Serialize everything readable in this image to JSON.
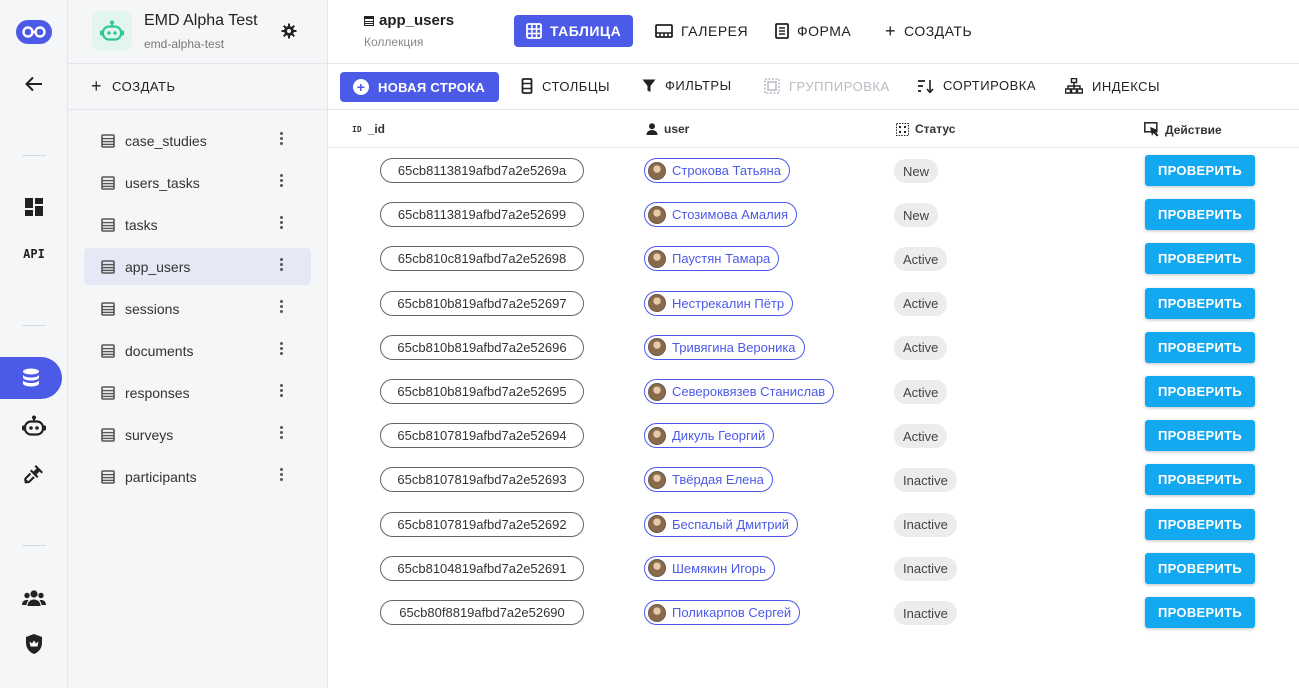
{
  "rail": {
    "api_label": "API",
    "items": [
      "logo-icon",
      "back-arrow-icon",
      "dashboard-icon",
      "api-icon",
      "database-icon",
      "bot-icon",
      "plug-icon",
      "users-icon",
      "shield-icon"
    ]
  },
  "project": {
    "name": "EMD Alpha Test",
    "slug": "emd-alpha-test"
  },
  "sidebar": {
    "create_label": "СОЗДАТЬ",
    "collections": [
      {
        "label": "case_studies"
      },
      {
        "label": "users_tasks"
      },
      {
        "label": "tasks"
      },
      {
        "label": "app_users",
        "active": true
      },
      {
        "label": "sessions"
      },
      {
        "label": "documents"
      },
      {
        "label": "responses"
      },
      {
        "label": "surveys"
      },
      {
        "label": "participants"
      }
    ]
  },
  "header": {
    "title": "app_users",
    "subtitle": "Коллекция",
    "views": [
      {
        "label": "ТАБЛИЦА",
        "active": true
      },
      {
        "label": "ГАЛЕРЕЯ"
      },
      {
        "label": "ФОРМА"
      },
      {
        "label": "СОЗДАТЬ"
      }
    ]
  },
  "toolbar": {
    "new_row": "НОВАЯ СТРОКА",
    "columns": "СТОЛБЦЫ",
    "filters": "ФИЛЬТРЫ",
    "grouping": "ГРУППИРОВКА",
    "sorting": "СОРТИРОВКА",
    "indexes": "ИНДЕКСЫ"
  },
  "table": {
    "headers": {
      "id_prefix": "ID",
      "id": "_id",
      "user": "user",
      "status": "Статус",
      "action": "Действие"
    },
    "action_label": "ПРОВЕРИТЬ",
    "rows": [
      {
        "id": "65cb8113819afbd7a2e5269a",
        "user": "Строкова Татьяна",
        "status": "New"
      },
      {
        "id": "65cb8113819afbd7a2e52699",
        "user": "Стозимова Амалия",
        "status": "New"
      },
      {
        "id": "65cb810c819afbd7a2e52698",
        "user": "Паустян Тамара",
        "status": "Active"
      },
      {
        "id": "65cb810b819afbd7a2e52697",
        "user": "Нестрекалин Пётр",
        "status": "Active"
      },
      {
        "id": "65cb810b819afbd7a2e52696",
        "user": "Тривягина Вероника",
        "status": "Active"
      },
      {
        "id": "65cb810b819afbd7a2e52695",
        "user": "Североквязев Станислав",
        "status": "Active"
      },
      {
        "id": "65cb8107819afbd7a2e52694",
        "user": "Дикуль Георгий",
        "status": "Active"
      },
      {
        "id": "65cb8107819afbd7a2e52693",
        "user": "Твёрдая Елена",
        "status": "Inactive"
      },
      {
        "id": "65cb8107819afbd7a2e52692",
        "user": "Беспалый Дмитрий",
        "status": "Inactive"
      },
      {
        "id": "65cb8104819afbd7a2e52691",
        "user": "Шемякин Игорь",
        "status": "Inactive"
      },
      {
        "id": "65cb80f8819afbd7a2e52690",
        "user": "Поликарпов Сергей",
        "status": "Inactive"
      }
    ]
  },
  "colors": {
    "accent": "#4c5ae8",
    "action": "#13a9f0",
    "status_bg": "#ececec",
    "project_logo": "#2fc79a"
  }
}
